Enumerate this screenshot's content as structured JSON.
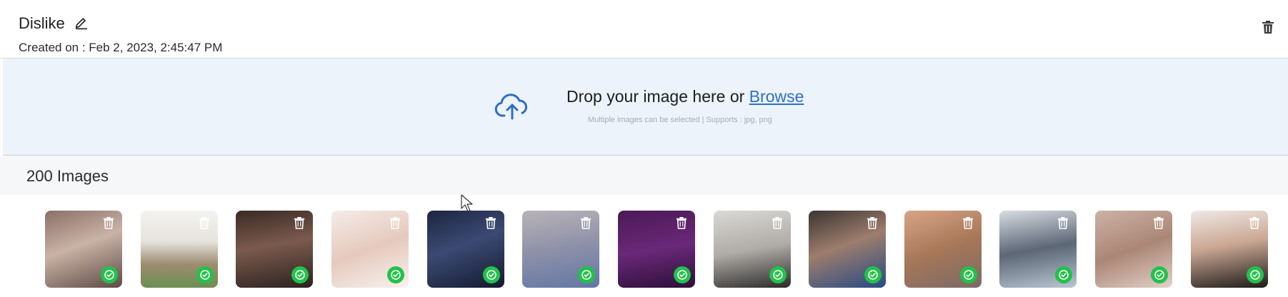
{
  "header": {
    "title": "Dislike",
    "created_label": "Created on : Feb 2, 2023, 2:45:47 PM",
    "icons": {
      "edit": "pencil-icon",
      "delete": "trash-icon"
    }
  },
  "dropzone": {
    "prompt": "Drop your image here or ",
    "browse_label": "Browse",
    "hint": "Multiple images can be selected | Supports : jpg, png",
    "icon": "cloud-upload-icon",
    "accent": "#2f6fc2"
  },
  "gallery": {
    "count_label": "200 Images",
    "status_color": "#21c24a",
    "thumbnails": [
      {
        "alt": "thumbnail 1"
      },
      {
        "alt": "thumbnail 2"
      },
      {
        "alt": "thumbnail 3"
      },
      {
        "alt": "thumbnail 4"
      },
      {
        "alt": "thumbnail 5"
      },
      {
        "alt": "thumbnail 6"
      },
      {
        "alt": "thumbnail 7"
      },
      {
        "alt": "thumbnail 8"
      },
      {
        "alt": "thumbnail 9"
      },
      {
        "alt": "thumbnail 10"
      },
      {
        "alt": "thumbnail 11"
      },
      {
        "alt": "thumbnail 12"
      },
      {
        "alt": "thumbnail 13"
      }
    ]
  }
}
